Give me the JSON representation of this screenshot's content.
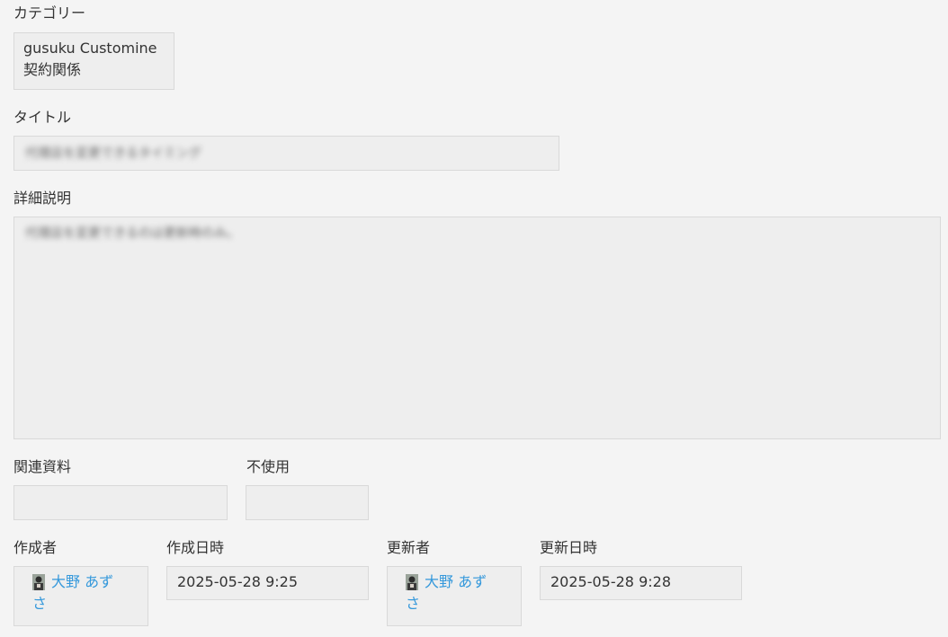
{
  "category": {
    "label": "カテゴリー",
    "value_line1": "gusuku Customine",
    "value_line2": "契約関係"
  },
  "title_field": {
    "label": "タイトル",
    "value": "代理店を変更できるタイミング"
  },
  "detail": {
    "label": "詳細説明",
    "lines": [
      "代理店を変更できるのは更新時のみ。",
      "",
      "",
      "",
      "",
      "",
      "",
      ""
    ]
  },
  "related": {
    "label": "関連資料",
    "value": ""
  },
  "unused": {
    "label": "不使用",
    "value": ""
  },
  "creator": {
    "label": "作成者",
    "name_line1": "大野 あず",
    "name_line2": "さ"
  },
  "created_at": {
    "label": "作成日時",
    "value": "2025-05-28 9:25"
  },
  "updater": {
    "label": "更新者",
    "name_line1": "大野 あず",
    "name_line2": "さ"
  },
  "updated_at": {
    "label": "更新日時",
    "value": "2025-05-28 9:28"
  },
  "colors": {
    "link": "#3498db",
    "background": "#f4f4f4",
    "field_bg": "#eeeeee",
    "border": "#d9d9d9"
  }
}
